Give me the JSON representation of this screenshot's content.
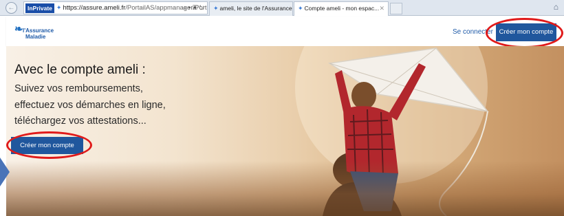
{
  "browser": {
    "inprivate_label": "InPrivate",
    "url_host": "https://assure.ameli.fr",
    "url_path": "/PortailAS/appmanager/Port",
    "tabs": [
      {
        "label": "ameli, le site de l'Assurance M...",
        "active": false
      },
      {
        "label": "Compte ameli - mon espac...",
        "active": true
      }
    ],
    "icons": [
      "back-icon",
      "search-icon",
      "lock-icon",
      "refresh-icon",
      "home-icon",
      "tab-close-icon"
    ]
  },
  "header": {
    "logo_line1": "l'Assurance",
    "logo_line2": "Maladie",
    "login_label": "Se connecter",
    "create_account_label": "Créer mon compte"
  },
  "hero": {
    "title": "Avec le compte ameli :",
    "lines": [
      "Suivez vos remboursements,",
      "effectuez vos démarches en ligne,",
      "téléchargez vos attestations..."
    ],
    "cta_label": "Créer mon compte"
  },
  "colors": {
    "primary": "#20579d",
    "highlight_ring": "#e01a1a",
    "link": "#1e5aa8"
  }
}
